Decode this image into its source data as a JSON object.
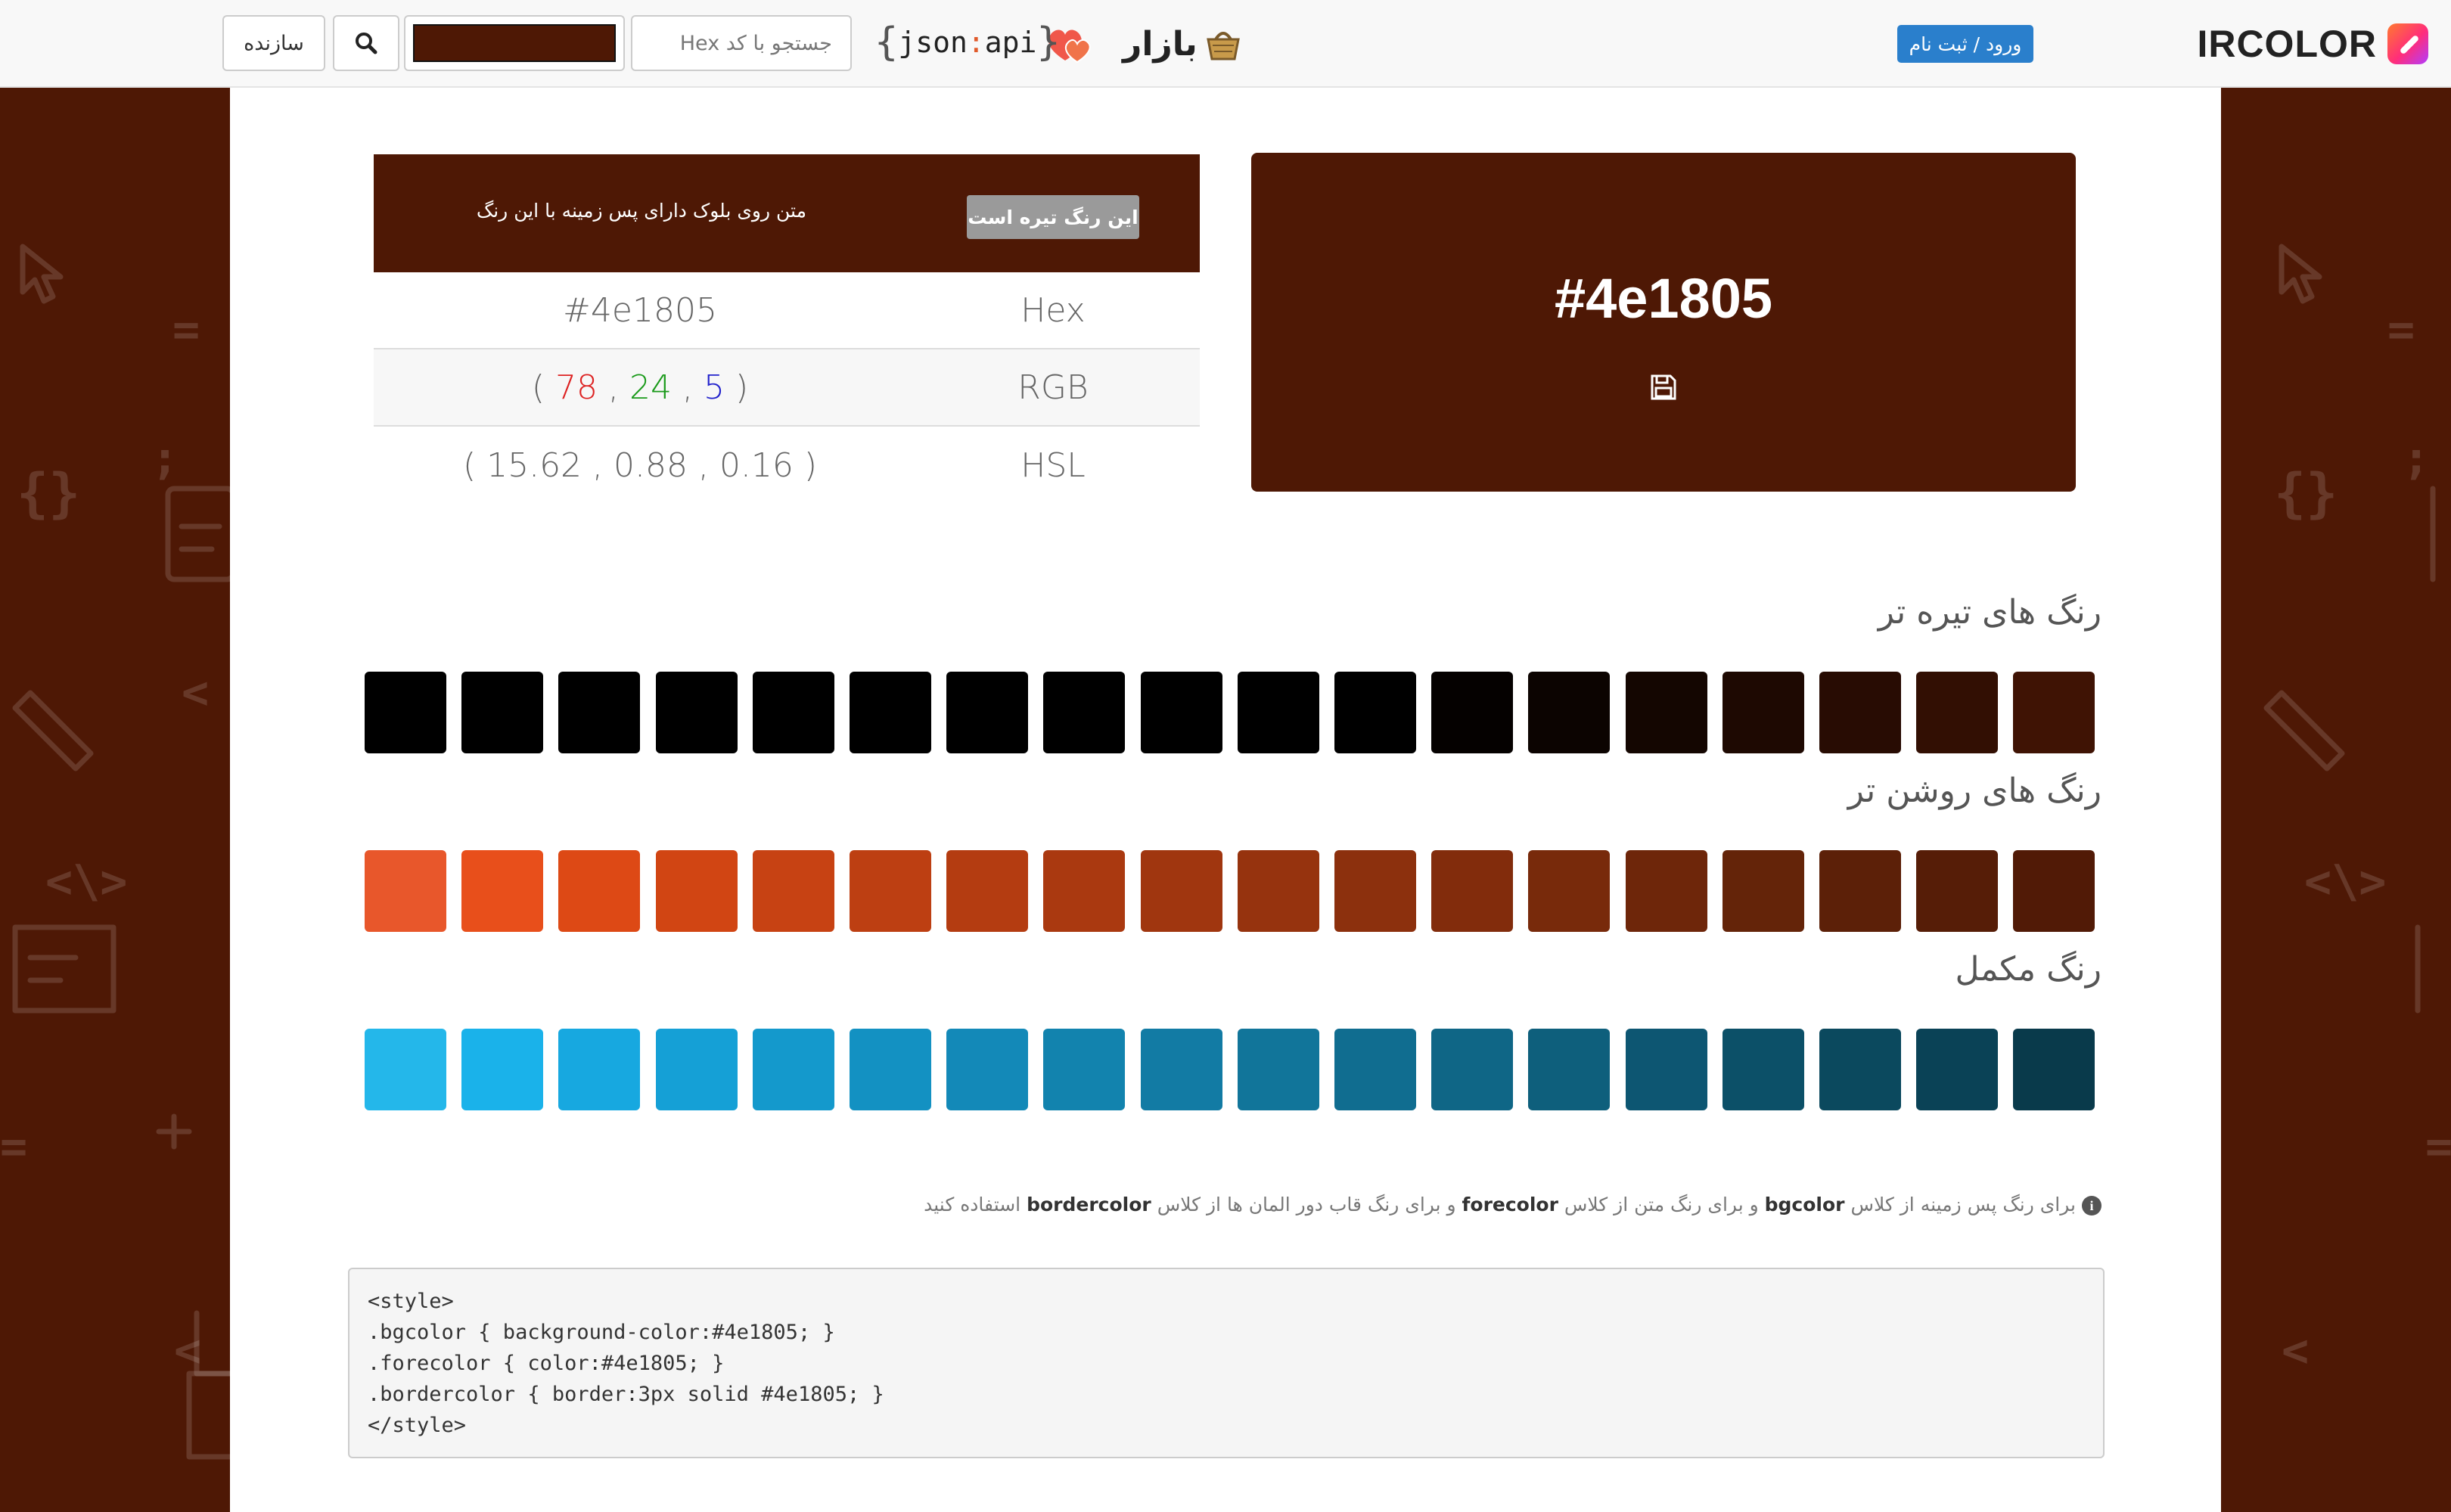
{
  "navbar": {
    "brand": "IRCOLOR",
    "login_label": "ورود / ثبت نام",
    "bazar_label": "بازار",
    "json_api": {
      "left": "{",
      "word1": "json",
      "colon": ":",
      "word2": "api",
      "right": "}"
    },
    "hex_placeholder": "جستجو با کد Hex",
    "search_icon": "search-icon",
    "builder_label": "سازنده",
    "picker_value": "#4e1805"
  },
  "color": {
    "hex": "#4e1805",
    "dark_badge": "این رنگ تیره است",
    "sample_text": "متن روی بلوک دارای پس زمینه با این رنگ",
    "rows": [
      {
        "label": "Hex",
        "value": "#4e1805"
      },
      {
        "label": "RGB",
        "open": "( ",
        "r": "78",
        "sep1": " , ",
        "g": "24",
        "sep2": " , ",
        "b": "5",
        "close": " )"
      },
      {
        "label": "HSL",
        "value": "( 15.62 , 0.88 , 0.16 )"
      }
    ]
  },
  "sections": {
    "darker_title": "رنگ های تیره تر",
    "lighter_title": "رنگ های روشن تر",
    "complement_title": "رنگ مکمل"
  },
  "palettes": {
    "darker": [
      "#000000",
      "#000000",
      "#000000",
      "#000000",
      "#000000",
      "#000000",
      "#000000",
      "#000000",
      "#000000",
      "#000000",
      "#000000",
      "#050100",
      "#0c0401",
      "#140601",
      "#1e0902",
      "#280c03",
      "#320f03",
      "#3f1304"
    ],
    "lighter": [
      "#e8572b",
      "#e84f1b",
      "#dd4915",
      "#d14513",
      "#c74213",
      "#bd3f12",
      "#b43c11",
      "#aa3910",
      "#a0360f",
      "#96330e",
      "#8c300d",
      "#822c0c",
      "#782a0b",
      "#6e260a",
      "#642409",
      "#5c2008",
      "#561d07",
      "#511a06"
    ],
    "complement": [
      "#24b7ea",
      "#1ab2ea",
      "#17a8e0",
      "#15a0d6",
      "#1499cc",
      "#1391c2",
      "#1389b8",
      "#1283ae",
      "#127ba4",
      "#11759a",
      "#106d90",
      "#0f6686",
      "#0e5f7c",
      "#0d5672",
      "#0c5068",
      "#0b495e",
      "#0a4256",
      "#093a4b"
    ]
  },
  "note": {
    "p1": "برای رنگ پس زمینه از کلاس",
    "c1": "bgcolor",
    "p2": "و برای رنگ متن از کلاس",
    "c2": "forecolor",
    "p3": "و برای رنگ قاب دور المان ها از کلاس",
    "c3": "bordercolor",
    "p4": "استفاده کنید"
  },
  "code": {
    "lines": [
      "<style>",
      ".bgcolor { background-color:#4e1805; }",
      ".forecolor { color:#4e1805; }",
      ".bordercolor { border:3px solid #4e1805; }",
      "</style>"
    ]
  },
  "colors": {
    "background": "#4e1805",
    "login_button": "#2a7fcc",
    "rgb_r": "#dd2222",
    "rgb_g": "#1a9a1a",
    "rgb_b": "#2222cc"
  }
}
